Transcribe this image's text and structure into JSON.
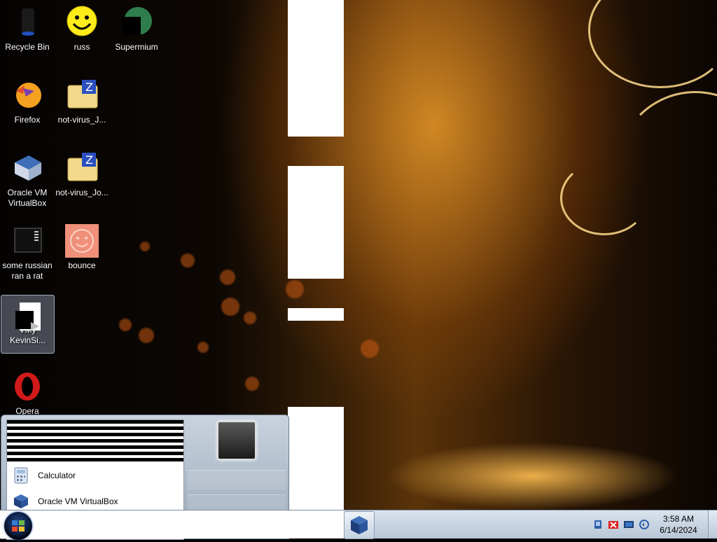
{
  "desktop": {
    "icons": [
      {
        "label": "Recycle Bin",
        "icon": "recycle-bin-icon"
      },
      {
        "label": "russ",
        "icon": "smiley-icon"
      },
      {
        "label": "Supermium",
        "icon": "supermium-icon"
      },
      {
        "label": "Firefox",
        "icon": "firefox-icon"
      },
      {
        "label": "not-virus_J...",
        "icon": "zip-folder-icon"
      },
      {
        "label": "Oracle VM VirtualBox",
        "icon": "virtualbox-icon"
      },
      {
        "label": "not-virus_Jo...",
        "icon": "zip-folder-icon"
      },
      {
        "label": "some russian ran a rat",
        "icon": "terminal-icon"
      },
      {
        "label": "bounce",
        "icon": "smiley-icon"
      },
      {
        "label": "VMy KevinSi...",
        "icon": "file-shortcut-icon"
      },
      {
        "label": "Opera",
        "icon": "opera-icon"
      }
    ]
  },
  "start_menu": {
    "programs": [
      {
        "label": "Calculator",
        "icon": "calculator-icon"
      },
      {
        "label": "Oracle VM VirtualBox",
        "icon": "virtualbox-icon"
      }
    ]
  },
  "taskbar": {
    "start_icon": "windows-orb-icon",
    "pinned": [
      {
        "icon": "virtualbox-icon"
      }
    ],
    "tray_icons": [
      "network-icon",
      "security-x-icon",
      "display-icon",
      "volume-icon"
    ],
    "time": "3:58 AM",
    "date": "6/14/2024"
  },
  "colors": {
    "taskbar_bg": "#c8d4e2",
    "wallpaper_accent": "#e9a23a"
  }
}
